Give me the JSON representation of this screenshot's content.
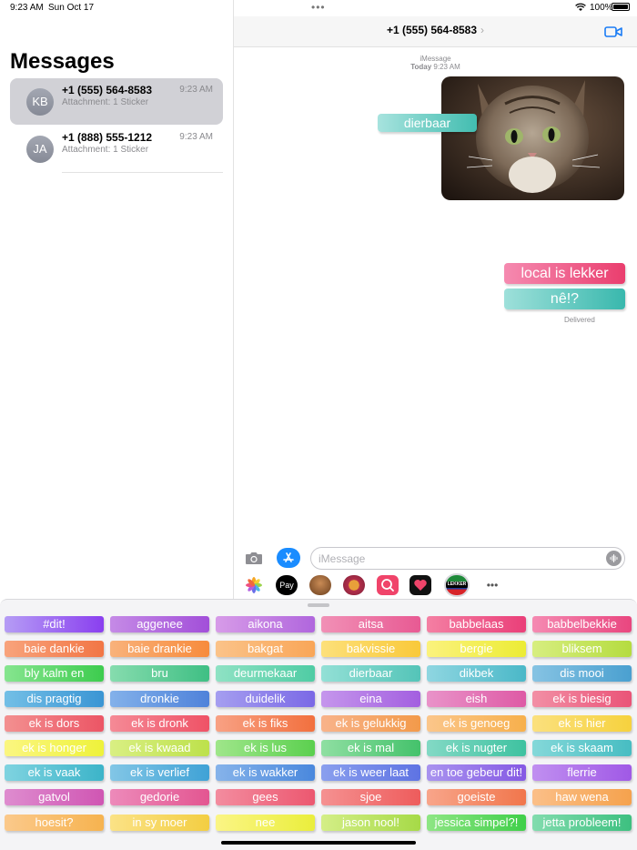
{
  "status_bar": {
    "time": "9:23 AM",
    "date": "Sun Oct 17",
    "battery": "100%",
    "dots": "•••"
  },
  "sidebar": {
    "title": "Messages",
    "conversations": [
      {
        "initials": "KB",
        "name": "+1 (555) 564-8583",
        "subtitle": "Attachment: 1 Sticker",
        "time": "9:23 AM",
        "selected": true
      },
      {
        "initials": "JA",
        "name": "+1 (888) 555-1212",
        "subtitle": "Attachment: 1 Sticker",
        "time": "9:23 AM",
        "selected": false
      }
    ]
  },
  "chat": {
    "contact": "+1 (555) 564-8583",
    "chevron": "›",
    "service": "iMessage",
    "timestamp_day": "Today",
    "timestamp_time": "9:23 AM",
    "photo_sticker": "dierbaar",
    "messages": [
      "local is lekker",
      "nê!?"
    ],
    "status": "Delivered"
  },
  "input": {
    "placeholder": "iMessage"
  },
  "app_drawer": {
    "icons": [
      "photos-icon",
      "apple-pay-icon",
      "memoji-icon",
      "animoji-icon",
      "image-search-icon",
      "digital-touch-icon",
      "lekker-sticker-app-icon",
      "more-icon"
    ],
    "apple_pay_label": "Pay",
    "lekker_label": "LEKKER",
    "more_label": "•••"
  },
  "stickers": [
    [
      "#dit!",
      "aggenee",
      "aikona",
      "aitsa",
      "babbelaas",
      "babbelbekkie"
    ],
    [
      "baie dankie",
      "baie drankie",
      "bakgat",
      "bakvissie",
      "bergie",
      "bliksem"
    ],
    [
      "bly kalm en",
      "bru",
      "deurmekaar",
      "dierbaar",
      "dikbek",
      "dis mooi"
    ],
    [
      "dis pragtig",
      "dronkie",
      "duidelik",
      "eina",
      "eish",
      "ek is biesig"
    ],
    [
      "ek is dors",
      "ek is dronk",
      "ek is fiks",
      "ek is gelukkig",
      "ek is genoeg",
      "ek is hier"
    ],
    [
      "ek is honger",
      "ek is kwaad",
      "ek is lus",
      "ek is mal",
      "ek is nugter",
      "ek is skaam"
    ],
    [
      "ek is vaak",
      "ek is verlief",
      "ek is wakker",
      "ek is weer laat",
      "en toe gebeur dit!",
      "flerrie"
    ],
    [
      "gatvol",
      "gedorie",
      "gees",
      "sjoe",
      "goeiste",
      "haw wena"
    ],
    [
      "hoesit?",
      "in sy moer",
      "nee",
      "jason nool!",
      "jessica simpel?!",
      "jetta probleem!"
    ]
  ],
  "sticker_gradients": [
    [
      "#b59cf5,#8a3fef",
      "#c58ae6,#a24fd9",
      "#d79be8,#b066dd",
      "#f190b6,#e85a93",
      "#f47fa3,#ea3f79",
      "#f58ab2,#e9467f"
    ],
    [
      "#f8a37c,#f27645",
      "#f9b27b,#f78b3c",
      "#fbc389,#f9a658",
      "#fde07a,#f9c93a",
      "#fbf27d,#ecec35",
      "#d7ee80,#b5dc3f"
    ],
    [
      "#86e58f,#3dcc4e",
      "#86dcae,#3fbf84",
      "#8fe2c4,#4fcca4",
      "#93e0d6,#54c4b8",
      "#8fd6e1,#4ab8c8",
      "#86c3e3,#4aa0d0"
    ],
    [
      "#73bfe6,#3a95d4",
      "#83b1ea,#4f82da",
      "#a59ef0,#7b69e6",
      "#c596ec,#a35fe0",
      "#e993c9,#de5aa5",
      "#f28fa5,#ea5478"
    ],
    [
      "#f39090,#ec5565",
      "#f58a96,#ef5266",
      "#f8a184,#f2703e",
      "#f8b38a,#f39a4a",
      "#fbc68b,#f7b04c",
      "#fbe07e,#f6d23e"
    ],
    [
      "#fbf681,#eef23a",
      "#d9ef83,#bde14b",
      "#9fe68a,#5bd04f",
      "#8fdfa2,#44c26b",
      "#83d9c5,#3ec2a0",
      "#84d8d9,#47bdc2"
    ],
    [
      "#7fd3e0,#3cb4c9",
      "#82c6e6,#3fa2d6",
      "#86b3ea,#4a88dd",
      "#8a9fee,#5e73e3",
      "#a993ef,#8559e4",
      "#c08ff0,#a059e6"
    ],
    [
      "#de8ccf,#d056b3",
      "#ed8aba,#e35691",
      "#f38c9f,#ec5870",
      "#f59191,#ee5c5c",
      "#f8a58a,#f1764c",
      "#fbbf88,#f5a24d"
    ],
    [
      "#fbc98b,#f6b34f",
      "#fbe286,#f3ce42",
      "#fbf585,#eaee3c",
      "#d4ee87,#a6da47",
      "#8ee684,#3fcf49",
      "#82dcae,#3dc080"
    ]
  ]
}
